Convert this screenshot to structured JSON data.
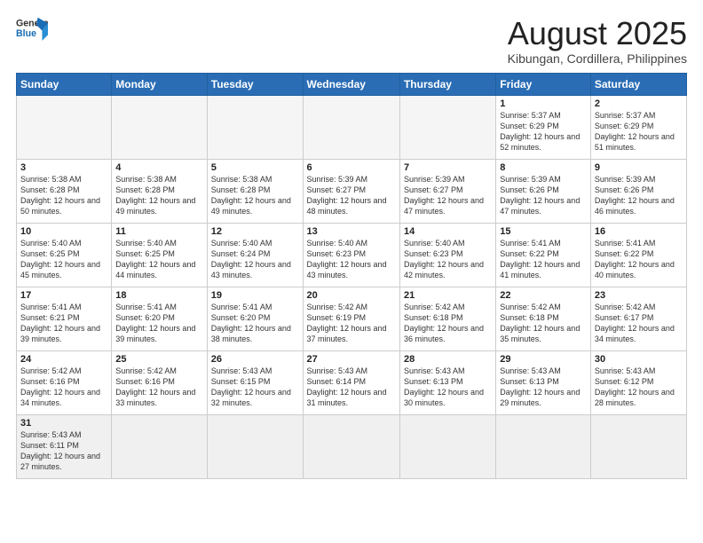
{
  "header": {
    "logo_general": "General",
    "logo_blue": "Blue",
    "title": "August 2025",
    "location": "Kibungan, Cordillera, Philippines"
  },
  "days_of_week": [
    "Sunday",
    "Monday",
    "Tuesday",
    "Wednesday",
    "Thursday",
    "Friday",
    "Saturday"
  ],
  "weeks": [
    [
      {
        "day": "",
        "info": ""
      },
      {
        "day": "",
        "info": ""
      },
      {
        "day": "",
        "info": ""
      },
      {
        "day": "",
        "info": ""
      },
      {
        "day": "",
        "info": ""
      },
      {
        "day": "1",
        "info": "Sunrise: 5:37 AM\nSunset: 6:29 PM\nDaylight: 12 hours\nand 52 minutes."
      },
      {
        "day": "2",
        "info": "Sunrise: 5:37 AM\nSunset: 6:29 PM\nDaylight: 12 hours\nand 51 minutes."
      }
    ],
    [
      {
        "day": "3",
        "info": "Sunrise: 5:38 AM\nSunset: 6:28 PM\nDaylight: 12 hours\nand 50 minutes."
      },
      {
        "day": "4",
        "info": "Sunrise: 5:38 AM\nSunset: 6:28 PM\nDaylight: 12 hours\nand 49 minutes."
      },
      {
        "day": "5",
        "info": "Sunrise: 5:38 AM\nSunset: 6:28 PM\nDaylight: 12 hours\nand 49 minutes."
      },
      {
        "day": "6",
        "info": "Sunrise: 5:39 AM\nSunset: 6:27 PM\nDaylight: 12 hours\nand 48 minutes."
      },
      {
        "day": "7",
        "info": "Sunrise: 5:39 AM\nSunset: 6:27 PM\nDaylight: 12 hours\nand 47 minutes."
      },
      {
        "day": "8",
        "info": "Sunrise: 5:39 AM\nSunset: 6:26 PM\nDaylight: 12 hours\nand 47 minutes."
      },
      {
        "day": "9",
        "info": "Sunrise: 5:39 AM\nSunset: 6:26 PM\nDaylight: 12 hours\nand 46 minutes."
      }
    ],
    [
      {
        "day": "10",
        "info": "Sunrise: 5:40 AM\nSunset: 6:25 PM\nDaylight: 12 hours\nand 45 minutes."
      },
      {
        "day": "11",
        "info": "Sunrise: 5:40 AM\nSunset: 6:25 PM\nDaylight: 12 hours\nand 44 minutes."
      },
      {
        "day": "12",
        "info": "Sunrise: 5:40 AM\nSunset: 6:24 PM\nDaylight: 12 hours\nand 43 minutes."
      },
      {
        "day": "13",
        "info": "Sunrise: 5:40 AM\nSunset: 6:23 PM\nDaylight: 12 hours\nand 43 minutes."
      },
      {
        "day": "14",
        "info": "Sunrise: 5:40 AM\nSunset: 6:23 PM\nDaylight: 12 hours\nand 42 minutes."
      },
      {
        "day": "15",
        "info": "Sunrise: 5:41 AM\nSunset: 6:22 PM\nDaylight: 12 hours\nand 41 minutes."
      },
      {
        "day": "16",
        "info": "Sunrise: 5:41 AM\nSunset: 6:22 PM\nDaylight: 12 hours\nand 40 minutes."
      }
    ],
    [
      {
        "day": "17",
        "info": "Sunrise: 5:41 AM\nSunset: 6:21 PM\nDaylight: 12 hours\nand 39 minutes."
      },
      {
        "day": "18",
        "info": "Sunrise: 5:41 AM\nSunset: 6:20 PM\nDaylight: 12 hours\nand 39 minutes."
      },
      {
        "day": "19",
        "info": "Sunrise: 5:41 AM\nSunset: 6:20 PM\nDaylight: 12 hours\nand 38 minutes."
      },
      {
        "day": "20",
        "info": "Sunrise: 5:42 AM\nSunset: 6:19 PM\nDaylight: 12 hours\nand 37 minutes."
      },
      {
        "day": "21",
        "info": "Sunrise: 5:42 AM\nSunset: 6:18 PM\nDaylight: 12 hours\nand 36 minutes."
      },
      {
        "day": "22",
        "info": "Sunrise: 5:42 AM\nSunset: 6:18 PM\nDaylight: 12 hours\nand 35 minutes."
      },
      {
        "day": "23",
        "info": "Sunrise: 5:42 AM\nSunset: 6:17 PM\nDaylight: 12 hours\nand 34 minutes."
      }
    ],
    [
      {
        "day": "24",
        "info": "Sunrise: 5:42 AM\nSunset: 6:16 PM\nDaylight: 12 hours\nand 34 minutes."
      },
      {
        "day": "25",
        "info": "Sunrise: 5:42 AM\nSunset: 6:16 PM\nDaylight: 12 hours\nand 33 minutes."
      },
      {
        "day": "26",
        "info": "Sunrise: 5:43 AM\nSunset: 6:15 PM\nDaylight: 12 hours\nand 32 minutes."
      },
      {
        "day": "27",
        "info": "Sunrise: 5:43 AM\nSunset: 6:14 PM\nDaylight: 12 hours\nand 31 minutes."
      },
      {
        "day": "28",
        "info": "Sunrise: 5:43 AM\nSunset: 6:13 PM\nDaylight: 12 hours\nand 30 minutes."
      },
      {
        "day": "29",
        "info": "Sunrise: 5:43 AM\nSunset: 6:13 PM\nDaylight: 12 hours\nand 29 minutes."
      },
      {
        "day": "30",
        "info": "Sunrise: 5:43 AM\nSunset: 6:12 PM\nDaylight: 12 hours\nand 28 minutes."
      }
    ],
    [
      {
        "day": "31",
        "info": "Sunrise: 5:43 AM\nSunset: 6:11 PM\nDaylight: 12 hours\nand 27 minutes."
      },
      {
        "day": "",
        "info": ""
      },
      {
        "day": "",
        "info": ""
      },
      {
        "day": "",
        "info": ""
      },
      {
        "day": "",
        "info": ""
      },
      {
        "day": "",
        "info": ""
      },
      {
        "day": "",
        "info": ""
      }
    ]
  ]
}
